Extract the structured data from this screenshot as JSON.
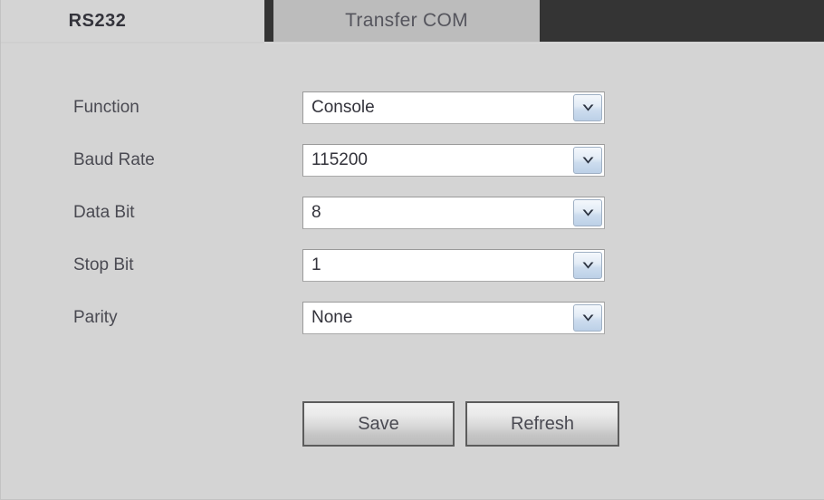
{
  "tabs": [
    {
      "id": "rs232",
      "label": "RS232",
      "active": true
    },
    {
      "id": "transfer-com",
      "label": "Transfer COM",
      "active": false
    }
  ],
  "form": {
    "rows": [
      {
        "id": "function",
        "label": "Function",
        "value": "Console",
        "icon": "chevron-down-icon"
      },
      {
        "id": "baud-rate",
        "label": "Baud Rate",
        "value": "115200",
        "icon": "chevron-down-icon"
      },
      {
        "id": "data-bit",
        "label": "Data Bit",
        "value": "8",
        "icon": "chevron-down-icon"
      },
      {
        "id": "stop-bit",
        "label": "Stop Bit",
        "value": "1",
        "icon": "chevron-down-icon"
      },
      {
        "id": "parity",
        "label": "Parity",
        "value": "None",
        "icon": "chevron-down-icon"
      }
    ]
  },
  "buttons": {
    "save_label": "Save",
    "refresh_label": "Refresh"
  },
  "colors": {
    "page_background": "#d4d4d4",
    "tabbar_background": "#343434",
    "active_tab_background": "#d4d4d4",
    "inactive_tab_background": "#bcbcbc",
    "label_text": "#4a4a52",
    "value_text": "#33333b",
    "select_background": "#ffffff",
    "select_border": "#a9a9a9",
    "arrow_button_accent": "#bcd0e7",
    "button_border": "#5c5c5c"
  }
}
